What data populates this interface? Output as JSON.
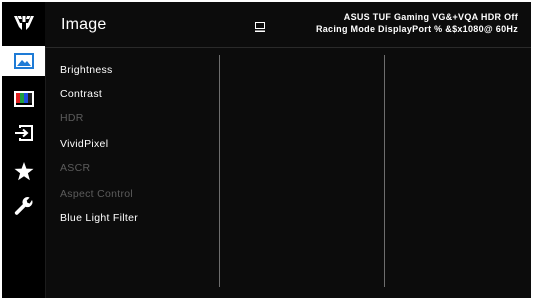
{
  "header": {
    "title": "Image",
    "status_line1": "ASUS TUF Gaming  VG&+VQA  HDR Off",
    "status_line2": "Racing Mode  DisplayPort  % &$x1080@ 60Hz"
  },
  "sidebar": {
    "items": [
      {
        "icon": "tuf-logo-icon",
        "active": false
      },
      {
        "icon": "image-icon",
        "active": true
      },
      {
        "icon": "color-bars-icon",
        "active": false
      },
      {
        "icon": "input-select-icon",
        "active": false
      },
      {
        "icon": "star-icon",
        "active": false
      },
      {
        "icon": "wrench-icon",
        "active": false
      }
    ]
  },
  "menu": {
    "items": [
      {
        "label": "Brightness",
        "enabled": true
      },
      {
        "label": "Contrast",
        "enabled": true
      },
      {
        "label": "HDR",
        "enabled": false
      },
      {
        "label": "VividPixel",
        "enabled": true
      },
      {
        "label": "ASCR",
        "enabled": false
      },
      {
        "label": "Aspect Control",
        "enabled": false
      },
      {
        "label": "Blue Light Filter",
        "enabled": true
      }
    ]
  },
  "colors": {
    "background": "#0c0c0c",
    "sidebar": "#000000",
    "active_tab": "#ffffff",
    "accent_blue": "#1e7bd6",
    "text": "#ffffff",
    "disabled_text": "#5c5c5c",
    "divider": "#6e6e6e"
  }
}
